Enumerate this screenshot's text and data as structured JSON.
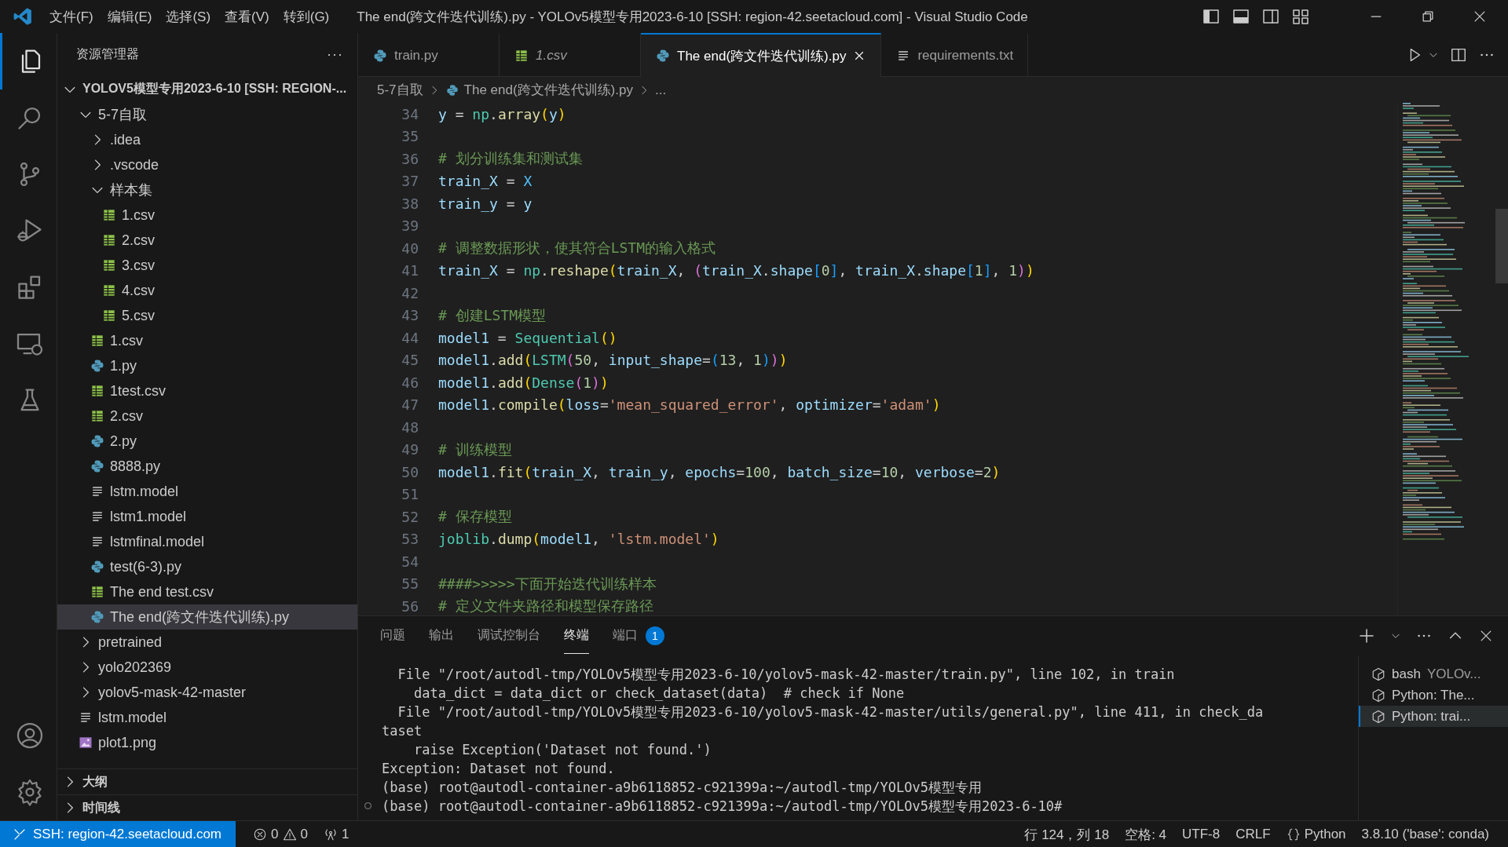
{
  "window": {
    "title": "The end(跨文件迭代训练).py - YOLOv5模型专用2023-6-10 [SSH: region-42.seetacloud.com] - Visual Studio Code"
  },
  "menu": [
    "文件(F)",
    "编辑(E)",
    "选择(S)",
    "查看(V)",
    "转到(G)"
  ],
  "activity_bar": [
    {
      "kind": "explorer",
      "selected": true
    },
    {
      "kind": "search",
      "selected": false
    },
    {
      "kind": "source-control",
      "selected": false
    },
    {
      "kind": "run-debug",
      "selected": false
    },
    {
      "kind": "extensions",
      "selected": false
    },
    {
      "kind": "remote",
      "selected": false
    },
    {
      "kind": "testing",
      "selected": false
    }
  ],
  "sidebar": {
    "title": "资源管理器",
    "more": "···",
    "root": {
      "label": "YOLOV5模型专用2023-6-10 [SSH: REGION-...",
      "expanded": true
    },
    "tree": [
      {
        "label": "5-7自取",
        "kind": "folder",
        "expanded": true,
        "selected": false,
        "children": [
          {
            "label": ".idea",
            "kind": "folder",
            "expanded": false,
            "selected": false
          },
          {
            "label": ".vscode",
            "kind": "folder",
            "expanded": false,
            "selected": false
          },
          {
            "label": "样本集",
            "kind": "folder",
            "expanded": true,
            "selected": false,
            "children": [
              {
                "label": "1.csv",
                "kind": "csv",
                "selected": false
              },
              {
                "label": "2.csv",
                "kind": "csv",
                "selected": false
              },
              {
                "label": "3.csv",
                "kind": "csv",
                "selected": false
              },
              {
                "label": "4.csv",
                "kind": "csv",
                "selected": false
              },
              {
                "label": "5.csv",
                "kind": "csv",
                "selected": false
              }
            ]
          },
          {
            "label": "1.csv",
            "kind": "csv",
            "selected": false
          },
          {
            "label": "1.py",
            "kind": "py",
            "selected": false
          },
          {
            "label": "1test.csv",
            "kind": "csv",
            "selected": false
          },
          {
            "label": "2.csv",
            "kind": "csv",
            "selected": false
          },
          {
            "label": "2.py",
            "kind": "py",
            "selected": false
          },
          {
            "label": "8888.py",
            "kind": "py",
            "selected": false
          },
          {
            "label": "lstm.model",
            "kind": "text",
            "selected": false
          },
          {
            "label": "lstm1.model",
            "kind": "text",
            "selected": false
          },
          {
            "label": "lstmfinal.model",
            "kind": "text",
            "selected": false
          },
          {
            "label": "test(6-3).py",
            "kind": "py",
            "selected": false
          },
          {
            "label": "The end test.csv",
            "kind": "csv",
            "selected": false
          },
          {
            "label": "The end(跨文件迭代训练).py",
            "kind": "py",
            "selected": true
          }
        ]
      },
      {
        "label": "pretrained",
        "kind": "folder",
        "expanded": false,
        "selected": false
      },
      {
        "label": "yolo202369",
        "kind": "folder",
        "expanded": false,
        "selected": false
      },
      {
        "label": "yolov5-mask-42-master",
        "kind": "folder",
        "expanded": false,
        "selected": false
      },
      {
        "label": "lstm.model",
        "kind": "text",
        "selected": false
      },
      {
        "label": "plot1.png",
        "kind": "image",
        "selected": false
      }
    ],
    "sections": [
      {
        "label": "大纲",
        "expanded": false
      },
      {
        "label": "时间线",
        "expanded": false
      }
    ]
  },
  "tabs": [
    {
      "label": "train.py",
      "kind": "py",
      "selected": false,
      "preview": false
    },
    {
      "label": "1.csv",
      "kind": "csv",
      "selected": false,
      "preview": true
    },
    {
      "label": "The end(跨文件迭代训练).py",
      "kind": "py",
      "selected": true,
      "preview": false
    },
    {
      "label": "requirements.txt",
      "kind": "text",
      "selected": false,
      "preview": false
    }
  ],
  "breadcrumb": [
    {
      "label": "5-7自取",
      "kind": "folder"
    },
    {
      "label": "The end(跨文件迭代训练).py",
      "kind": "py"
    },
    {
      "label": "...",
      "kind": "more"
    }
  ],
  "code": [
    {
      "number": "34",
      "tokens": [
        {
          "kind": "var",
          "text": "y"
        },
        {
          "kind": "op",
          "text": " = "
        },
        {
          "kind": "module",
          "text": "np"
        },
        {
          "kind": "op",
          "text": "."
        },
        {
          "kind": "func",
          "text": "array"
        },
        {
          "kind": "b1",
          "text": "("
        },
        {
          "kind": "var",
          "text": "y"
        },
        {
          "kind": "b1",
          "text": ")"
        }
      ]
    },
    {
      "number": "35"
    },
    {
      "number": "36",
      "tokens": [
        {
          "kind": "comment",
          "text": "# 划分训练集和测试集"
        }
      ]
    },
    {
      "number": "37",
      "tokens": [
        {
          "kind": "var",
          "text": "train_X"
        },
        {
          "kind": "op",
          "text": " = "
        },
        {
          "kind": "const",
          "text": "X"
        }
      ]
    },
    {
      "number": "38",
      "tokens": [
        {
          "kind": "var",
          "text": "train_y"
        },
        {
          "kind": "op",
          "text": " = "
        },
        {
          "kind": "var",
          "text": "y"
        }
      ]
    },
    {
      "number": "39"
    },
    {
      "number": "40",
      "tokens": [
        {
          "kind": "comment",
          "text": "# 调整数据形状，使其符合LSTM的输入格式"
        }
      ]
    },
    {
      "number": "41",
      "tokens": [
        {
          "kind": "var",
          "text": "train_X"
        },
        {
          "kind": "op",
          "text": " = "
        },
        {
          "kind": "module",
          "text": "np"
        },
        {
          "kind": "op",
          "text": "."
        },
        {
          "kind": "func",
          "text": "reshape"
        },
        {
          "kind": "b1",
          "text": "("
        },
        {
          "kind": "var",
          "text": "train_X"
        },
        {
          "kind": "op",
          "text": ", "
        },
        {
          "kind": "b2",
          "text": "("
        },
        {
          "kind": "var",
          "text": "train_X"
        },
        {
          "kind": "op",
          "text": "."
        },
        {
          "kind": "var",
          "text": "shape"
        },
        {
          "kind": "b3",
          "text": "["
        },
        {
          "kind": "num",
          "text": "0"
        },
        {
          "kind": "b3",
          "text": "]"
        },
        {
          "kind": "op",
          "text": ", "
        },
        {
          "kind": "var",
          "text": "train_X"
        },
        {
          "kind": "op",
          "text": "."
        },
        {
          "kind": "var",
          "text": "shape"
        },
        {
          "kind": "b3",
          "text": "["
        },
        {
          "kind": "num",
          "text": "1"
        },
        {
          "kind": "b3",
          "text": "]"
        },
        {
          "kind": "op",
          "text": ", "
        },
        {
          "kind": "num",
          "text": "1"
        },
        {
          "kind": "b2",
          "text": ")"
        },
        {
          "kind": "b1",
          "text": ")"
        }
      ]
    },
    {
      "number": "42"
    },
    {
      "number": "43",
      "tokens": [
        {
          "kind": "comment",
          "text": "# 创建LSTM模型"
        }
      ]
    },
    {
      "number": "44",
      "tokens": [
        {
          "kind": "var",
          "text": "model1"
        },
        {
          "kind": "op",
          "text": " = "
        },
        {
          "kind": "class",
          "text": "Sequential"
        },
        {
          "kind": "b1",
          "text": "("
        },
        {
          "kind": "b1",
          "text": ")"
        }
      ]
    },
    {
      "number": "45",
      "tokens": [
        {
          "kind": "var",
          "text": "model1"
        },
        {
          "kind": "op",
          "text": "."
        },
        {
          "kind": "func",
          "text": "add"
        },
        {
          "kind": "b1",
          "text": "("
        },
        {
          "kind": "class",
          "text": "LSTM"
        },
        {
          "kind": "b2",
          "text": "("
        },
        {
          "kind": "num",
          "text": "50"
        },
        {
          "kind": "op",
          "text": ", "
        },
        {
          "kind": "var",
          "text": "input_shape"
        },
        {
          "kind": "op",
          "text": "="
        },
        {
          "kind": "b3",
          "text": "("
        },
        {
          "kind": "num",
          "text": "13"
        },
        {
          "kind": "op",
          "text": ", "
        },
        {
          "kind": "num",
          "text": "1"
        },
        {
          "kind": "b3",
          "text": ")"
        },
        {
          "kind": "b2",
          "text": ")"
        },
        {
          "kind": "b1",
          "text": ")"
        }
      ]
    },
    {
      "number": "46",
      "tokens": [
        {
          "kind": "var",
          "text": "model1"
        },
        {
          "kind": "op",
          "text": "."
        },
        {
          "kind": "func",
          "text": "add"
        },
        {
          "kind": "b1",
          "text": "("
        },
        {
          "kind": "class",
          "text": "Dense"
        },
        {
          "kind": "b2",
          "text": "("
        },
        {
          "kind": "num",
          "text": "1"
        },
        {
          "kind": "b2",
          "text": ")"
        },
        {
          "kind": "b1",
          "text": ")"
        }
      ]
    },
    {
      "number": "47",
      "tokens": [
        {
          "kind": "var",
          "text": "model1"
        },
        {
          "kind": "op",
          "text": "."
        },
        {
          "kind": "func",
          "text": "compile"
        },
        {
          "kind": "b1",
          "text": "("
        },
        {
          "kind": "var",
          "text": "loss"
        },
        {
          "kind": "op",
          "text": "="
        },
        {
          "kind": "str",
          "text": "'mean_squared_error'"
        },
        {
          "kind": "op",
          "text": ", "
        },
        {
          "kind": "var",
          "text": "optimizer"
        },
        {
          "kind": "op",
          "text": "="
        },
        {
          "kind": "str",
          "text": "'adam'"
        },
        {
          "kind": "b1",
          "text": ")"
        }
      ]
    },
    {
      "number": "48"
    },
    {
      "number": "49",
      "tokens": [
        {
          "kind": "comment",
          "text": "# 训练模型"
        }
      ]
    },
    {
      "number": "50",
      "tokens": [
        {
          "kind": "var",
          "text": "model1"
        },
        {
          "kind": "op",
          "text": "."
        },
        {
          "kind": "func",
          "text": "fit"
        },
        {
          "kind": "b1",
          "text": "("
        },
        {
          "kind": "var",
          "text": "train_X"
        },
        {
          "kind": "op",
          "text": ", "
        },
        {
          "kind": "var",
          "text": "train_y"
        },
        {
          "kind": "op",
          "text": ", "
        },
        {
          "kind": "var",
          "text": "epochs"
        },
        {
          "kind": "op",
          "text": "="
        },
        {
          "kind": "num",
          "text": "100"
        },
        {
          "kind": "op",
          "text": ", "
        },
        {
          "kind": "var",
          "text": "batch_size"
        },
        {
          "kind": "op",
          "text": "="
        },
        {
          "kind": "num",
          "text": "10"
        },
        {
          "kind": "op",
          "text": ", "
        },
        {
          "kind": "var",
          "text": "verbose"
        },
        {
          "kind": "op",
          "text": "="
        },
        {
          "kind": "num",
          "text": "2"
        },
        {
          "kind": "b1",
          "text": ")"
        }
      ]
    },
    {
      "number": "51"
    },
    {
      "number": "52",
      "tokens": [
        {
          "kind": "comment",
          "text": "# 保存模型"
        }
      ]
    },
    {
      "number": "53",
      "tokens": [
        {
          "kind": "module",
          "text": "joblib"
        },
        {
          "kind": "op",
          "text": "."
        },
        {
          "kind": "func",
          "text": "dump"
        },
        {
          "kind": "b1",
          "text": "("
        },
        {
          "kind": "var",
          "text": "model1"
        },
        {
          "kind": "op",
          "text": ", "
        },
        {
          "kind": "str",
          "text": "'lstm.model'"
        },
        {
          "kind": "b1",
          "text": ")"
        }
      ]
    },
    {
      "number": "54"
    },
    {
      "number": "55",
      "tokens": [
        {
          "kind": "comment",
          "text": "####>>>>>下面开始迭代训练样本"
        }
      ]
    },
    {
      "number": "56",
      "tokens": [
        {
          "kind": "comment",
          "text": "# 定义文件夹路径和模型保存路径"
        }
      ]
    }
  ],
  "panel": {
    "tabs": [
      {
        "label": "问题",
        "selected": false
      },
      {
        "label": "输出",
        "selected": false
      },
      {
        "label": "调试控制台",
        "selected": false
      },
      {
        "label": "终端",
        "selected": true
      },
      {
        "label": "端口",
        "selected": false,
        "badge": "1"
      }
    ],
    "terminal_lines": [
      {
        "text": "  File \"/root/autodl-tmp/YOLOv5模型专用2023-6-10/yolov5-mask-42-master/train.py\", line 102, in train",
        "decorated": false
      },
      {
        "text": "    data_dict = data_dict or check_dataset(data)  # check if None",
        "decorated": false
      },
      {
        "text": "  File \"/root/autodl-tmp/YOLOv5模型专用2023-6-10/yolov5-mask-42-master/utils/general.py\", line 411, in check_da",
        "decorated": false
      },
      {
        "text": "taset",
        "decorated": false
      },
      {
        "text": "    raise Exception('Dataset not found.')",
        "decorated": false
      },
      {
        "text": "Exception: Dataset not found.",
        "decorated": false
      },
      {
        "text": "(base) root@autodl-container-a9b6118852-c921399a:~/autodl-tmp/YOLOv5模型专用",
        "decorated": false
      },
      {
        "text": "(base) root@autodl-container-a9b6118852-c921399a:~/autodl-tmp/YOLOv5模型专用2023-6-10#",
        "decorated": true
      }
    ],
    "terminals": [
      {
        "name": "bash",
        "detail": "YOLOv...",
        "selected": false
      },
      {
        "name": "Python: The...",
        "selected": false
      },
      {
        "name": "Python: trai...",
        "selected": true
      }
    ]
  },
  "status_bar": {
    "remote": "SSH: region-42.seetacloud.com",
    "errors": "0",
    "warnings": "0",
    "ports": "1",
    "right": [
      {
        "kind": "text",
        "text": "行 124，列 18"
      },
      {
        "kind": "text",
        "text": "空格: 4"
      },
      {
        "kind": "text",
        "text": "UTF-8"
      },
      {
        "kind": "text",
        "text": "CRLF"
      },
      {
        "kind": "language",
        "text": "Python"
      },
      {
        "kind": "text",
        "text": "3.8.10 ('base': conda)"
      }
    ]
  }
}
